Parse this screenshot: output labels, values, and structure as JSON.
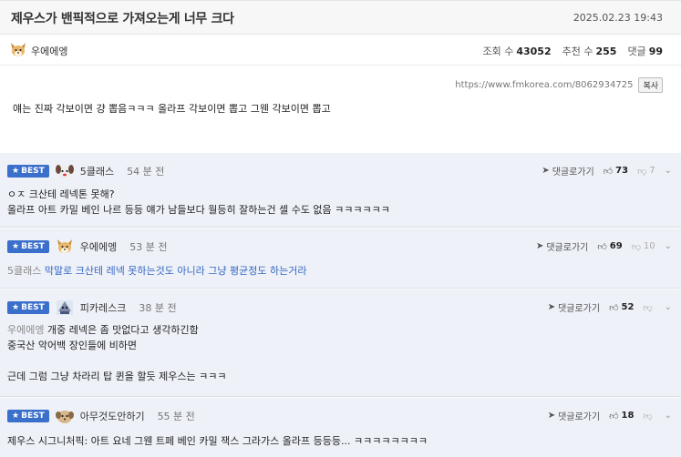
{
  "post": {
    "title": "제우스가 밴픽적으로 가져오는게 너무 크다",
    "date": "2025.02.23 19:43",
    "author": "우에에엥",
    "views_label": "조회 수",
    "views": "43052",
    "likes_label": "추천 수",
    "likes": "255",
    "comments_label": "댓글",
    "comments": "99",
    "url": "https://www.fmkorea.com/8062934725",
    "copy_label": "복사",
    "body": "얘는 진짜 각보이면 걍 뽑음ㅋㅋㅋ 올라프 각보이면 뽑고 그웬 각보이면 뽑고"
  },
  "labels": {
    "best": "BEST",
    "reply": "댓글로가기"
  },
  "comments": [
    {
      "name": "5클래스",
      "time": "54 분 전",
      "up": "73",
      "down": "7",
      "lines": [
        "ㅇㅈ 크산테 레넥톤 못해?",
        "올라프 아트 카밀 베인 나르 등등 얘가 남들보다 월등히 잘하는건 셀 수도 없음 ㅋㅋㅋㅋㅋㅋ"
      ]
    },
    {
      "name": "우에에엥",
      "time": "53 분 전",
      "up": "69",
      "down": "10",
      "mention": "5클래스",
      "lines": [
        "막말로 크산테 레넥 못하는것도 아니라 그냥 평균정도 하는거라"
      ]
    },
    {
      "name": "피카레스크",
      "time": "38 분 전",
      "up": "52",
      "down": "",
      "mention": "우에에엥",
      "lines": [
        "개중 레넥은 좀 맛없다고 생각하긴함",
        "중국산 악어백 장인들에 비하면",
        "",
        "근데 그럼 그냥 차라리 탑 퀸을 할듯 제우스는 ㅋㅋㅋ"
      ]
    },
    {
      "name": "아무것도안하기",
      "time": "55 분 전",
      "up": "18",
      "down": "",
      "lines": [
        "제우스 시그니처픽: 아트 요네 그웬 트페 베인 카밀 잭스 그라가스 올라프 등등등... ㅋㅋㅋㅋㅋㅋㅋㅋ"
      ]
    }
  ],
  "colors": {
    "best_badge": "#3b6fcc",
    "comment_bg": "#eef1f8",
    "blue_text": "#3568c4"
  }
}
